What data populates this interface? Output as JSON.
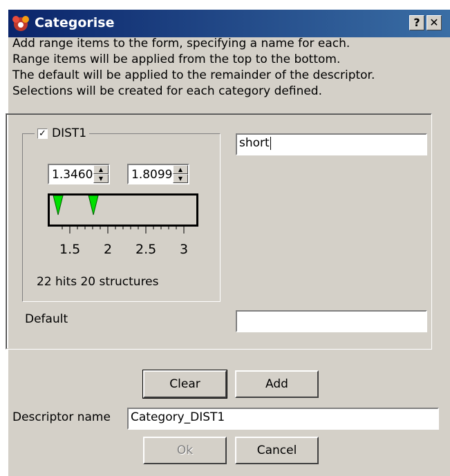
{
  "window": {
    "title": "Categorise",
    "help_label": "?",
    "close_label": "✕",
    "accent_color": "#0a246a"
  },
  "intro": [
    "Add range items to the form, specifying a name for each.",
    "Range items will be applied from the top to the bottom.",
    "The default will be applied to the remainder of the descriptor.",
    "Selections will be created for each category defined."
  ],
  "range_item": {
    "checked": true,
    "check_mark": "✓",
    "label": "DIST1",
    "name_value": "short",
    "min_value": "1.3460",
    "max_value": "1.8099",
    "tick_labels": [
      "1.5",
      "2",
      "2.5",
      "3"
    ],
    "slider_range": [
      1.3,
      3.1
    ],
    "handle_color": "#00e000",
    "stats": "22 hits 20 structures"
  },
  "default": {
    "label": "Default",
    "value": ""
  },
  "buttons": {
    "clear": "Clear",
    "add": "Add",
    "ok": "Ok",
    "cancel": "Cancel"
  },
  "descriptor": {
    "label": "Descriptor name",
    "value": "Category_DIST1"
  }
}
